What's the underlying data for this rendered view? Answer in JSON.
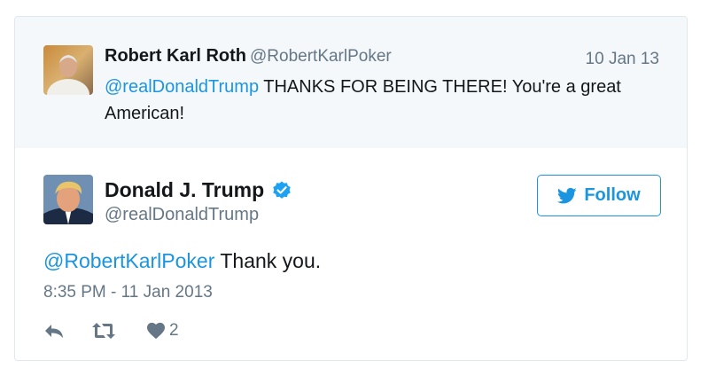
{
  "quoted_tweet": {
    "author_name": "Robert Karl Roth",
    "author_handle": "@RobertKarlPoker",
    "date": "10 Jan 13",
    "mention": "@realDonaldTrump",
    "text": " THANKS FOR BEING THERE! You're a great American!"
  },
  "main_tweet": {
    "author_name": "Donald J. Trump",
    "author_handle": "@realDonaldTrump",
    "verified": true,
    "mention": "@RobertKarlPoker",
    "text": " Thank you.",
    "timestamp": "8:35 PM - 11 Jan 2013",
    "like_count": "2"
  },
  "follow_button": {
    "label": "Follow"
  },
  "icons": [
    "twitter-bird-icon",
    "verified-badge-icon",
    "reply-icon",
    "retweet-icon",
    "heart-icon"
  ],
  "colors": {
    "link": "#1b95e0",
    "secondary_text": "#657786",
    "quoted_bg": "#f5f8fa",
    "border": "#e1e8ed"
  }
}
